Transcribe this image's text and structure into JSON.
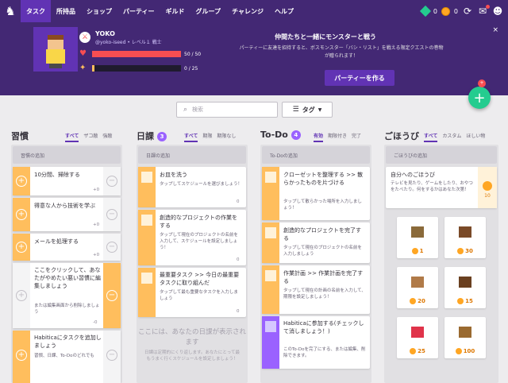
{
  "nav": {
    "items": [
      "タスク",
      "所持品",
      "ショップ",
      "パーティー",
      "ギルド",
      "グループ",
      "チャレンジ",
      "ヘルプ"
    ],
    "gems": "0",
    "gold": "0"
  },
  "user": {
    "name": "YOKO",
    "sub": "@yoko-iseed • レベル１ 戦士",
    "hp": "50 / 50",
    "hp_fraction": 1.0,
    "xp": "0 / 25",
    "xp_fraction": 0.03
  },
  "party": {
    "title": "仲間たちと一緒にモンスターと戦う",
    "desc": "パーティーに友達を招待すると、ボスモンスター「バシ・リスト」を戦える限定クエストの巻物が贈られます！",
    "button": "パーティーを作る",
    "close": "×"
  },
  "plus_badge": "+",
  "search": {
    "placeholder": "検索"
  },
  "tag": {
    "label": "タグ"
  },
  "habits": {
    "title": "習慣",
    "tabs": [
      "すべて",
      "ザコ敵",
      "強敵"
    ],
    "add": "習慣の追加",
    "cards": [
      {
        "title": "10分間、掃除する",
        "count": "+0"
      },
      {
        "title": "得意な人から技術を学ぶ",
        "count": "+0"
      },
      {
        "title": "メールを処理する",
        "count": "+0"
      },
      {
        "title": "ここをクリックして、あなたがやめたい悪い習慣に編集しましょう",
        "note": "または編集画面から削除しましょう",
        "count": "-0"
      },
      {
        "title": "Habiticaにタスクを追加しましょう",
        "note": "習慣、日課、To-Doのどれでも"
      }
    ]
  },
  "dailies": {
    "title": "日課",
    "count": "3",
    "tabs": [
      "すべて",
      "期限",
      "期限なし"
    ],
    "add": "日課の追加",
    "cards": [
      {
        "title": "お皿を洗う",
        "note": "タップしてスケジュールを選びましょう！",
        "count": "0"
      },
      {
        "title": "創造的なプロジェクトの作業をする",
        "note": "タップして現在のプロジェクトの名前を入力して、スケジュールを設定しましょう！",
        "count": "0"
      },
      {
        "title": "最重要タスク >> 今日の最重要タスクに取り組んだ",
        "note": "タップして最も重要なタスクを入力しましょう",
        "count": "0"
      }
    ],
    "placeholder_title": "ここには、あなたの日課が表示されます",
    "placeholder_desc": "日課は定期的にくり返します。あなたにとって最もうまく行くスケジュールを設定しましょう！"
  },
  "todos": {
    "title": "To-Do",
    "count": "4",
    "tabs": [
      "有効",
      "期限付き",
      "完了"
    ],
    "add": "To-Doの追加",
    "cards": [
      {
        "title": "クローゼットを整理する >> 散らかったものを片づける",
        "note": "タップして散らかった場所を入力しましょう！"
      },
      {
        "title": "創造的なプロジェクトを完了する",
        "note": "タップして現在のプロジェクトの名前を入力しましょう"
      },
      {
        "title": "作業計画 >> 作業計画を完了する",
        "note": "タップして現在の計画の名前を入力して、期限を設定しましょう！"
      },
      {
        "title": "Habiticaに参加する(チェックして消しましょう！)",
        "note": "このTo-Doを完了にする、または編集、削除できます。"
      }
    ]
  },
  "rewards": {
    "title": "ごほうび",
    "tabs": [
      "すべて",
      "カスタム",
      "ほしい物"
    ],
    "add": "ごほうびの追加",
    "custom": {
      "title": "自分へのごほうび",
      "note": "テレビを見たり、ゲームをしたり、おやつをたべたり。何をするかはあなた次第！",
      "price": "10"
    },
    "items": [
      {
        "name": "training-sword",
        "price": "1",
        "color": "#8a6a3a"
      },
      {
        "name": "leather-armor",
        "price": "30",
        "color": "#7a4a28"
      },
      {
        "name": "potion-cookie",
        "price": "20",
        "color": "#b07a48"
      },
      {
        "name": "leather-helm",
        "price": "15",
        "color": "#6a4020"
      },
      {
        "name": "health-potion",
        "price": "25",
        "color": "#e0334a"
      },
      {
        "name": "treasure-chest",
        "price": "100",
        "color": "#9a6a30"
      }
    ]
  }
}
